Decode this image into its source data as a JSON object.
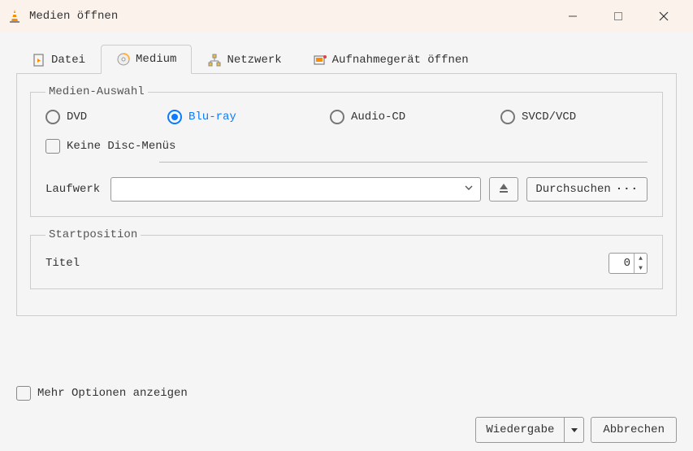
{
  "window": {
    "title": "Medien öffnen"
  },
  "tabs": {
    "file": "Datei",
    "disc": "Medium",
    "network": "Netzwerk",
    "capture": "Aufnahmegerät öffnen"
  },
  "media_selection": {
    "legend": "Medien-Auswahl",
    "dvd": "DVD",
    "bluray": "Blu-ray",
    "audiocd": "Audio-CD",
    "svcd": "SVCD/VCD",
    "no_disc_menus": "Keine Disc-Menüs",
    "drive_label": "Laufwerk",
    "browse": "Durchsuchen"
  },
  "start_position": {
    "legend": "Startposition",
    "title_label": "Titel",
    "title_value": "0"
  },
  "footer": {
    "more_options": "Mehr Optionen anzeigen",
    "play": "Wiedergabe",
    "cancel": "Abbrechen"
  }
}
